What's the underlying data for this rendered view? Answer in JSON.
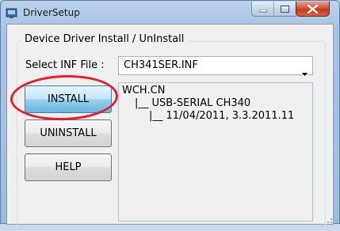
{
  "window": {
    "title": "DriverSetup",
    "icon": "installer-app-icon",
    "controls": [
      "minimize-icon",
      "maximize-icon",
      "close-icon"
    ],
    "close_color": "#c7381d"
  },
  "group": {
    "legend": "Device Driver Install / UnInstall"
  },
  "inf": {
    "label": "Select INF File :",
    "selected": "CH341SER.INF"
  },
  "buttons": {
    "install": "INSTALL",
    "uninstall": "UNINSTALL",
    "help": "HELP"
  },
  "driver_info": {
    "vendor": "WCH.CN",
    "device": "|__ USB-SERIAL CH340",
    "version": "|__ 11/04/2011, 3.3.2011.11"
  },
  "annotation": {
    "highlight_color": "#e0202b"
  }
}
